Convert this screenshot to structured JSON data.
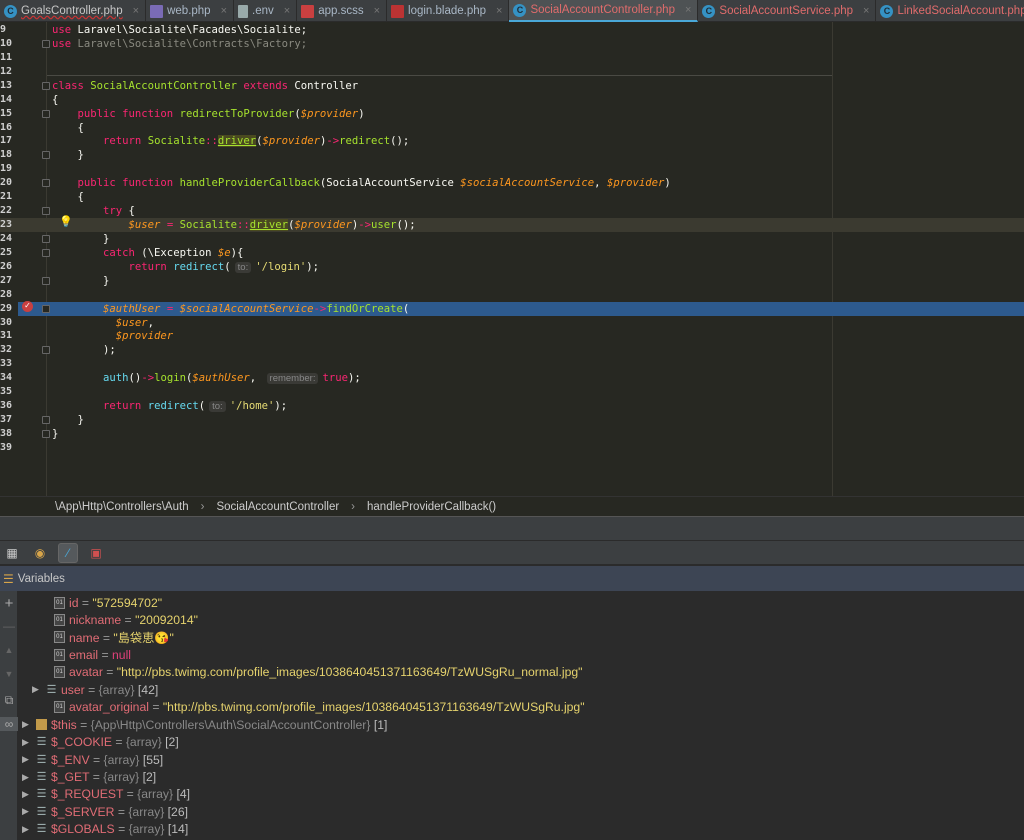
{
  "tabs": [
    {
      "label": "GoalsController.php",
      "icon": "class-icon",
      "style": "wavy"
    },
    {
      "label": "web.php",
      "icon": "php-file-icon"
    },
    {
      "label": ".env",
      "icon": "text-file-icon"
    },
    {
      "label": "app.scss",
      "icon": "sass-file-icon"
    },
    {
      "label": "login.blade.php",
      "icon": "blade-file-icon"
    },
    {
      "label": "SocialAccountController.php",
      "icon": "class-icon",
      "style": "red",
      "active": true
    },
    {
      "label": "SocialAccountService.php",
      "icon": "class-icon",
      "style": "red"
    },
    {
      "label": "LinkedSocialAccount.php",
      "icon": "class-icon",
      "style": "red"
    }
  ],
  "code": [
    {
      "n": "9",
      "t": [
        [
          "k",
          "use"
        ],
        [
          "p",
          " Laravel\\Socialite\\Facades\\Socialite;"
        ]
      ]
    },
    {
      "n": "10",
      "fold": true,
      "t": [
        [
          "k",
          "use"
        ],
        [
          "g",
          " Laravel\\Socialite\\Contracts\\Factory;"
        ]
      ]
    },
    {
      "n": "11",
      "t": []
    },
    {
      "n": "12",
      "t": []
    },
    {
      "n": "13",
      "fold": true,
      "t": [
        [
          "k",
          "class"
        ],
        [
          "p",
          " "
        ],
        [
          "f",
          "SocialAccountController"
        ],
        [
          "p",
          " "
        ],
        [
          "k",
          "extends"
        ],
        [
          "p",
          " Controller"
        ]
      ]
    },
    {
      "n": "14",
      "t": [
        [
          "p",
          "{"
        ]
      ]
    },
    {
      "n": "15",
      "fold": true,
      "t": [
        [
          "p",
          "    "
        ],
        [
          "k",
          "public function"
        ],
        [
          "p",
          " "
        ],
        [
          "f",
          "redirectToProvider"
        ],
        [
          "p",
          "("
        ],
        [
          "v",
          "$provider"
        ],
        [
          "p",
          ")"
        ]
      ]
    },
    {
      "n": "16",
      "t": [
        [
          "p",
          "    {"
        ]
      ]
    },
    {
      "n": "17",
      "t": [
        [
          "p",
          "        "
        ],
        [
          "k",
          "return"
        ],
        [
          "p",
          " "
        ],
        [
          "f",
          "Socialite"
        ],
        [
          "k",
          "::"
        ],
        [
          "u",
          "driver"
        ],
        [
          "p",
          "("
        ],
        [
          "v",
          "$provider"
        ],
        [
          "p",
          ")"
        ],
        [
          "k",
          "->"
        ],
        [
          "f",
          "redirect"
        ],
        [
          "p",
          "();"
        ]
      ]
    },
    {
      "n": "18",
      "fold": true,
      "t": [
        [
          "p",
          "    }"
        ]
      ]
    },
    {
      "n": "19",
      "t": []
    },
    {
      "n": "20",
      "fold": true,
      "t": [
        [
          "p",
          "    "
        ],
        [
          "k",
          "public function"
        ],
        [
          "p",
          " "
        ],
        [
          "f",
          "handleProviderCallback"
        ],
        [
          "p",
          "(SocialAccountService "
        ],
        [
          "v",
          "$socialAccountService"
        ],
        [
          "p",
          ", "
        ],
        [
          "v",
          "$provider"
        ],
        [
          "p",
          ")"
        ]
      ]
    },
    {
      "n": "21",
      "t": [
        [
          "p",
          "    {"
        ]
      ]
    },
    {
      "n": "22",
      "fold": true,
      "t": [
        [
          "p",
          "        "
        ],
        [
          "k",
          "try"
        ],
        [
          "p",
          " {"
        ]
      ]
    },
    {
      "n": "23",
      "cur": true,
      "t": [
        [
          "p",
          "            "
        ],
        [
          "v",
          "$user"
        ],
        [
          "p",
          " "
        ],
        [
          "k",
          "="
        ],
        [
          "p",
          " "
        ],
        [
          "f",
          "Socialite"
        ],
        [
          "k",
          "::"
        ],
        [
          "u",
          "driver"
        ],
        [
          "p",
          "("
        ],
        [
          "v",
          "$provider"
        ],
        [
          "p",
          ")"
        ],
        [
          "k",
          "->"
        ],
        [
          "f",
          "user"
        ],
        [
          "p",
          "();"
        ]
      ]
    },
    {
      "n": "24",
      "fold": true,
      "t": [
        [
          "p",
          "        }"
        ]
      ]
    },
    {
      "n": "25",
      "fold": true,
      "t": [
        [
          "p",
          "        "
        ],
        [
          "k",
          "catch"
        ],
        [
          "p",
          " (\\Exception "
        ],
        [
          "v",
          "$e"
        ],
        [
          "p",
          "){"
        ]
      ]
    },
    {
      "n": "26",
      "t": [
        [
          "p",
          "            "
        ],
        [
          "k",
          "return"
        ],
        [
          "p",
          " "
        ],
        [
          "c",
          "redirect"
        ],
        [
          "p",
          "("
        ],
        [
          "h",
          "to:"
        ],
        [
          "s",
          "'/login'"
        ],
        [
          "p",
          ");"
        ]
      ]
    },
    {
      "n": "27",
      "fold": true,
      "t": [
        [
          "p",
          "        }"
        ]
      ]
    },
    {
      "n": "28",
      "t": []
    },
    {
      "n": "29",
      "bp": true,
      "fold": true,
      "t": [
        [
          "p",
          "        "
        ],
        [
          "v",
          "$authUser"
        ],
        [
          "p",
          " "
        ],
        [
          "k",
          "="
        ],
        [
          "p",
          " "
        ],
        [
          "v",
          "$socialAccountService"
        ],
        [
          "k",
          "->"
        ],
        [
          "f",
          "findOrCreate"
        ],
        [
          "p",
          "("
        ]
      ]
    },
    {
      "n": "30",
      "t": [
        [
          "p",
          "          "
        ],
        [
          "v",
          "$user"
        ],
        [
          "p",
          ","
        ]
      ]
    },
    {
      "n": "31",
      "t": [
        [
          "p",
          "          "
        ],
        [
          "v",
          "$provider"
        ]
      ]
    },
    {
      "n": "32",
      "fold": true,
      "t": [
        [
          "p",
          "        );"
        ]
      ]
    },
    {
      "n": "33",
      "t": []
    },
    {
      "n": "34",
      "t": [
        [
          "p",
          "        "
        ],
        [
          "c",
          "auth"
        ],
        [
          "p",
          "()"
        ],
        [
          "k",
          "->"
        ],
        [
          "f",
          "login"
        ],
        [
          "p",
          "("
        ],
        [
          "v",
          "$authUser"
        ],
        [
          "p",
          ", "
        ],
        [
          "h",
          "remember:"
        ],
        [
          "k",
          "true"
        ],
        [
          "p",
          ");"
        ]
      ]
    },
    {
      "n": "35",
      "t": []
    },
    {
      "n": "36",
      "t": [
        [
          "p",
          "        "
        ],
        [
          "k",
          "return"
        ],
        [
          "p",
          " "
        ],
        [
          "c",
          "redirect"
        ],
        [
          "p",
          "("
        ],
        [
          "h",
          "to:"
        ],
        [
          "s",
          "'/home'"
        ],
        [
          "p",
          ");"
        ]
      ]
    },
    {
      "n": "37",
      "fold": true,
      "t": [
        [
          "p",
          "    }"
        ]
      ]
    },
    {
      "n": "38",
      "fold": true,
      "t": [
        [
          "p",
          "}"
        ]
      ]
    },
    {
      "n": "39",
      "t": []
    }
  ],
  "breadcrumb": [
    "\\App\\Http\\Controllers\\Auth",
    "SocialAccountController",
    "handleProviderCallback()"
  ],
  "breadcrumb_sep": "›",
  "variables_title": "Variables",
  "variables": [
    {
      "indent": 2,
      "icon": "field",
      "name": "id",
      "eq": " = ",
      "value": "\"572594702\"",
      "vtype": "str"
    },
    {
      "indent": 2,
      "icon": "field",
      "name": "nickname",
      "eq": " = ",
      "value": "\"20092014\"",
      "vtype": "str"
    },
    {
      "indent": 2,
      "icon": "field",
      "name": "name",
      "eq": " = ",
      "value": "\"島袋恵😘\"",
      "vtype": "str"
    },
    {
      "indent": 2,
      "icon": "field",
      "name": "email",
      "eq": " = ",
      "value": "null",
      "vtype": "null"
    },
    {
      "indent": 2,
      "icon": "field",
      "name": "avatar",
      "eq": " = ",
      "value": "\"http://pbs.twimg.com/profile_images/1038640451371163649/TzWUSgRu_normal.jpg\"",
      "vtype": "str"
    },
    {
      "indent": 1,
      "expand": true,
      "icon": "array",
      "name": "user",
      "eq": " = ",
      "type": "{array}",
      "count": "[42]"
    },
    {
      "indent": 2,
      "icon": "field",
      "name": "avatar_original",
      "eq": " = ",
      "value": "\"http://pbs.twimg.com/profile_images/1038640451371163649/TzWUSgRu.jpg\"",
      "vtype": "str"
    },
    {
      "indent": 0,
      "expand": true,
      "icon": "object",
      "name": "$this",
      "eq": " = ",
      "type": "{App\\Http\\Controllers\\Auth\\SocialAccountController}",
      "count": "[1]"
    },
    {
      "indent": 0,
      "expand": true,
      "icon": "array",
      "name": "$_COOKIE",
      "eq": " = ",
      "type": "{array}",
      "count": "[2]"
    },
    {
      "indent": 0,
      "expand": true,
      "icon": "array",
      "name": "$_ENV",
      "eq": " = ",
      "type": "{array}",
      "count": "[55]"
    },
    {
      "indent": 0,
      "expand": true,
      "icon": "array",
      "name": "$_GET",
      "eq": " = ",
      "type": "{array}",
      "count": "[2]"
    },
    {
      "indent": 0,
      "expand": true,
      "icon": "array",
      "name": "$_REQUEST",
      "eq": " = ",
      "type": "{array}",
      "count": "[4]"
    },
    {
      "indent": 0,
      "expand": true,
      "icon": "array",
      "name": "$_SERVER",
      "eq": " = ",
      "type": "{array}",
      "count": "[26]"
    },
    {
      "indent": 0,
      "expand": true,
      "icon": "array",
      "name": "$GLOBALS",
      "eq": " = ",
      "type": "{array}",
      "count": "[14]"
    }
  ]
}
